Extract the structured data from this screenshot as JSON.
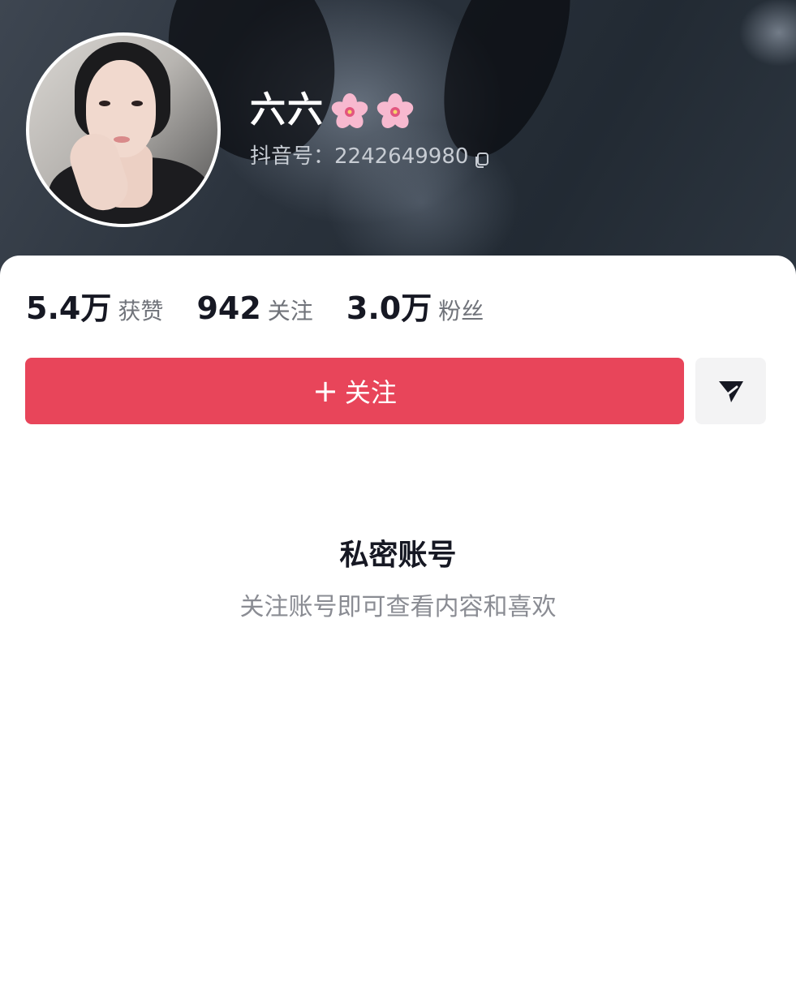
{
  "profile": {
    "name": "六六",
    "name_emoji": [
      "cherry-blossom-icon",
      "cherry-blossom-icon"
    ],
    "douyin_id_label": "抖音号：",
    "douyin_id": "2242649980"
  },
  "stats": [
    {
      "value": "5.4万",
      "label": "获赞"
    },
    {
      "value": "942",
      "label": "关注"
    },
    {
      "value": "3.0万",
      "label": "粉丝"
    }
  ],
  "actions": {
    "follow_plus": "+",
    "follow_label": "关注",
    "share_icon": "send-icon"
  },
  "private": {
    "title": "私密账号",
    "subtitle": "关注账号即可查看内容和喜欢"
  },
  "colors": {
    "accent": "#e8455a",
    "text_primary": "#161823",
    "text_secondary": "#8a8c93"
  }
}
